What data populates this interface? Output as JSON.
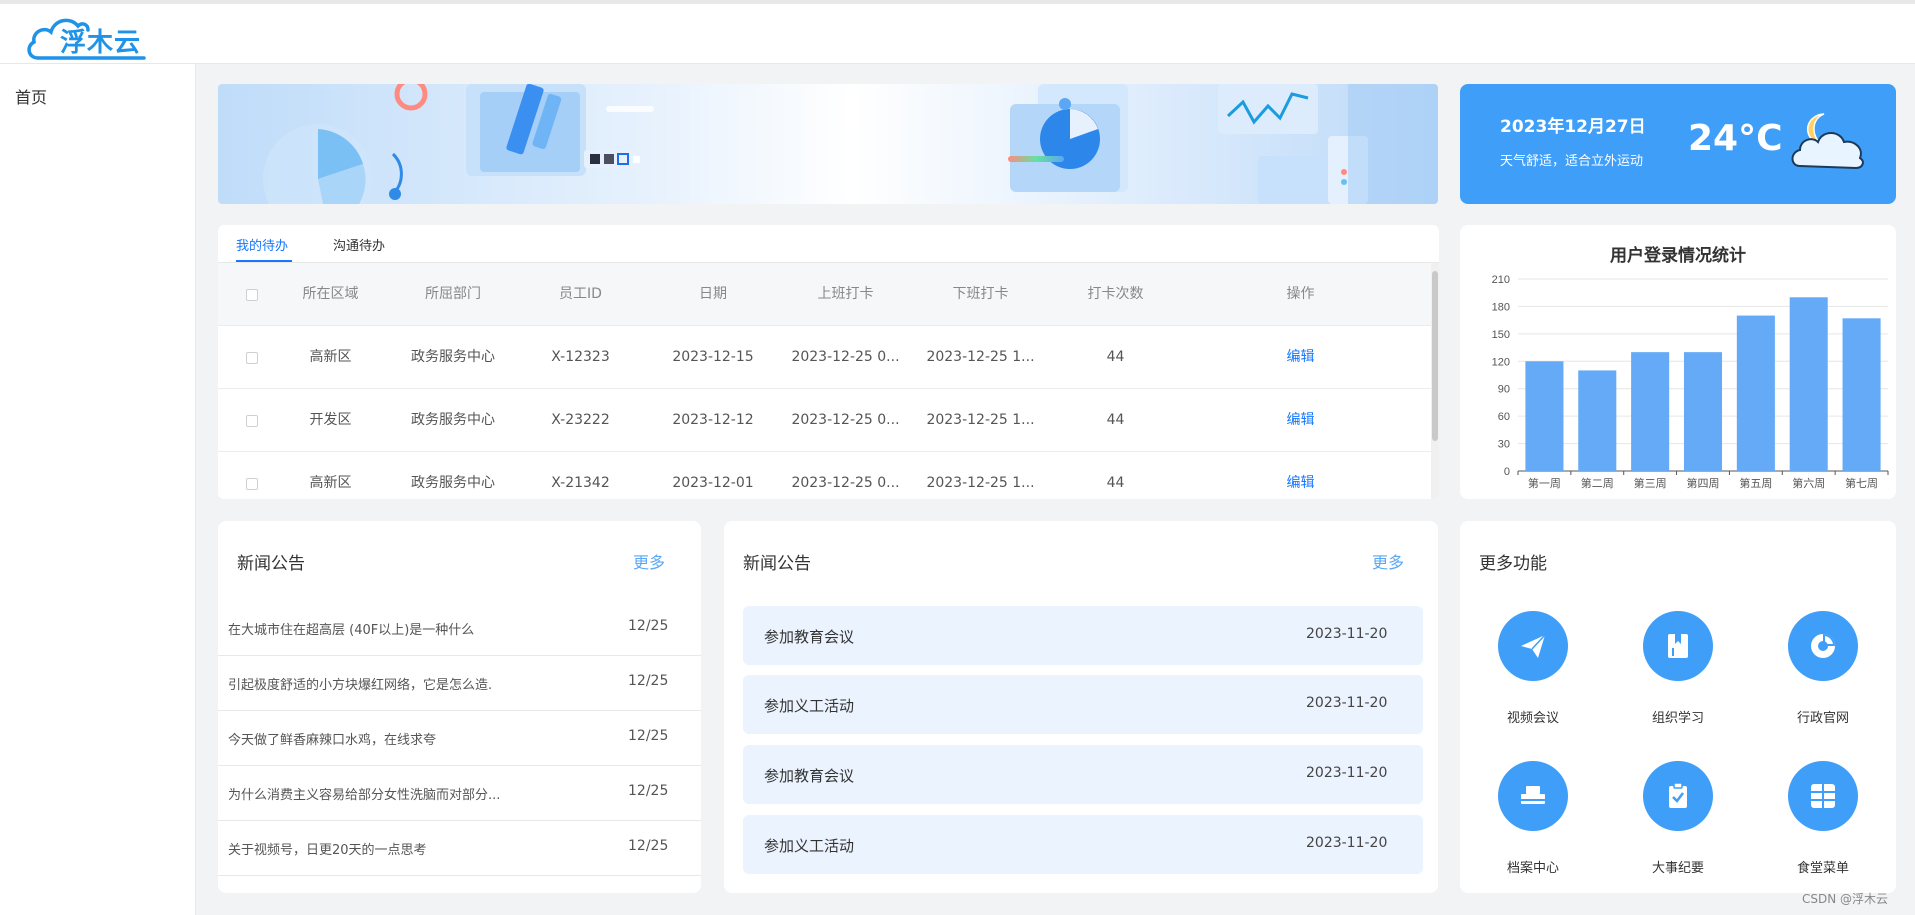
{
  "header": {
    "logo_text": "浮木云"
  },
  "sidebar": {
    "items": [
      {
        "label": "首页"
      }
    ]
  },
  "weather": {
    "date": "2023年12月27日",
    "desc": "天气舒适，适合立外运动",
    "temp": "24°C",
    "icon": "moon-cloud-icon"
  },
  "todo": {
    "tabs": [
      {
        "label": "我的待办",
        "active": true
      },
      {
        "label": "沟通待办",
        "active": false
      }
    ],
    "columns": [
      "所在区域",
      "所屈部门",
      "员工ID",
      "日期",
      "上班打卡",
      "下班打卡",
      "打卡次数",
      "操作"
    ],
    "rows": [
      {
        "area": "高新区",
        "dept": "政务服务中心",
        "id": "X-12323",
        "date": "2023-12-15",
        "in": "2023-12-25 0...",
        "out": "2023-12-25 1...",
        "count": "44",
        "action": "编辑"
      },
      {
        "area": "开发区",
        "dept": "政务服务中心",
        "id": "X-23222",
        "date": "2023-12-12",
        "in": "2023-12-25 0...",
        "out": "2023-12-25 1...",
        "count": "44",
        "action": "编辑"
      },
      {
        "area": "高新区",
        "dept": "政务服务中心",
        "id": "X-21342",
        "date": "2023-12-01",
        "in": "2023-12-25 0...",
        "out": "2023-12-25 1...",
        "count": "44",
        "action": "编辑"
      }
    ]
  },
  "chart_data": {
    "type": "bar",
    "title": "用户登录情况统计",
    "categories": [
      "第一周",
      "第二周",
      "第三周",
      "第四周",
      "第五周",
      "第六周",
      "第七周"
    ],
    "values": [
      120,
      110,
      130,
      130,
      170,
      190,
      167
    ],
    "ylim": [
      0,
      210
    ],
    "yticks": [
      0,
      30,
      60,
      90,
      120,
      150,
      180,
      210
    ],
    "color": "#64aaf7",
    "grid": true
  },
  "news1": {
    "title": "新闻公告",
    "more": "更多",
    "items": [
      {
        "title": "在大城市住在超高层 (40F以上)是一种什么",
        "date": "12/25"
      },
      {
        "title": "引起极度舒适的小方块爆红网络，它是怎么造.",
        "date": "12/25"
      },
      {
        "title": "今天做了鲜香麻辣口水鸡，在线求夸",
        "date": "12/25"
      },
      {
        "title": "为什么消费主义容易给部分女性洗脑而对部分...",
        "date": "12/25"
      },
      {
        "title": "关于视频号，日更20天的一点思考",
        "date": "12/25"
      }
    ]
  },
  "news2": {
    "title": "新闻公告",
    "more": "更多",
    "items": [
      {
        "title": "参加教育会议",
        "date": "2023-11-20"
      },
      {
        "title": "参加义工活动",
        "date": "2023-11-20"
      },
      {
        "title": "参加教育会议",
        "date": "2023-11-20"
      },
      {
        "title": "参加义工活动",
        "date": "2023-11-20"
      }
    ]
  },
  "functions": {
    "title": "更多功能",
    "items": [
      {
        "label": "视频会议",
        "icon": "paper-plane-icon"
      },
      {
        "label": "组织学习",
        "icon": "book-icon"
      },
      {
        "label": "行政官网",
        "icon": "pie-chart-icon"
      },
      {
        "label": "档案中心",
        "icon": "archive-icon"
      },
      {
        "label": "大事纪要",
        "icon": "clipboard-check-icon"
      },
      {
        "label": "食堂菜单",
        "icon": "grid-menu-icon"
      }
    ]
  },
  "watermark": "CSDN @浮木云"
}
